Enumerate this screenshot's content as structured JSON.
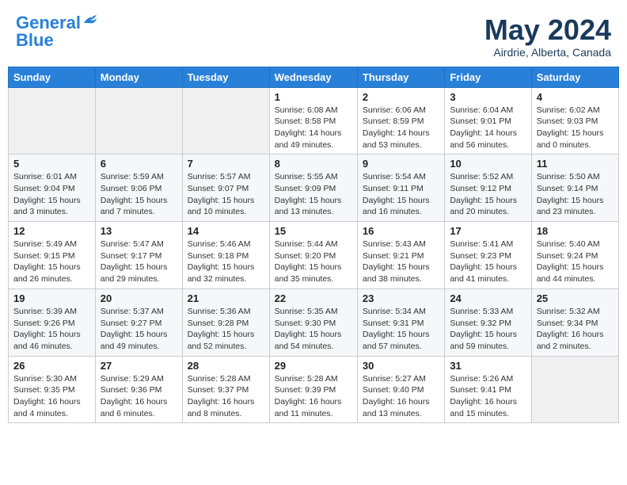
{
  "header": {
    "logo_line1": "General",
    "logo_line2": "Blue",
    "month_year": "May 2024",
    "location": "Airdrie, Alberta, Canada"
  },
  "weekdays": [
    "Sunday",
    "Monday",
    "Tuesday",
    "Wednesday",
    "Thursday",
    "Friday",
    "Saturday"
  ],
  "weeks": [
    [
      {
        "day": "",
        "info": ""
      },
      {
        "day": "",
        "info": ""
      },
      {
        "day": "",
        "info": ""
      },
      {
        "day": "1",
        "info": "Sunrise: 6:08 AM\nSunset: 8:58 PM\nDaylight: 14 hours\nand 49 minutes."
      },
      {
        "day": "2",
        "info": "Sunrise: 6:06 AM\nSunset: 8:59 PM\nDaylight: 14 hours\nand 53 minutes."
      },
      {
        "day": "3",
        "info": "Sunrise: 6:04 AM\nSunset: 9:01 PM\nDaylight: 14 hours\nand 56 minutes."
      },
      {
        "day": "4",
        "info": "Sunrise: 6:02 AM\nSunset: 9:03 PM\nDaylight: 15 hours\nand 0 minutes."
      }
    ],
    [
      {
        "day": "5",
        "info": "Sunrise: 6:01 AM\nSunset: 9:04 PM\nDaylight: 15 hours\nand 3 minutes."
      },
      {
        "day": "6",
        "info": "Sunrise: 5:59 AM\nSunset: 9:06 PM\nDaylight: 15 hours\nand 7 minutes."
      },
      {
        "day": "7",
        "info": "Sunrise: 5:57 AM\nSunset: 9:07 PM\nDaylight: 15 hours\nand 10 minutes."
      },
      {
        "day": "8",
        "info": "Sunrise: 5:55 AM\nSunset: 9:09 PM\nDaylight: 15 hours\nand 13 minutes."
      },
      {
        "day": "9",
        "info": "Sunrise: 5:54 AM\nSunset: 9:11 PM\nDaylight: 15 hours\nand 16 minutes."
      },
      {
        "day": "10",
        "info": "Sunrise: 5:52 AM\nSunset: 9:12 PM\nDaylight: 15 hours\nand 20 minutes."
      },
      {
        "day": "11",
        "info": "Sunrise: 5:50 AM\nSunset: 9:14 PM\nDaylight: 15 hours\nand 23 minutes."
      }
    ],
    [
      {
        "day": "12",
        "info": "Sunrise: 5:49 AM\nSunset: 9:15 PM\nDaylight: 15 hours\nand 26 minutes."
      },
      {
        "day": "13",
        "info": "Sunrise: 5:47 AM\nSunset: 9:17 PM\nDaylight: 15 hours\nand 29 minutes."
      },
      {
        "day": "14",
        "info": "Sunrise: 5:46 AM\nSunset: 9:18 PM\nDaylight: 15 hours\nand 32 minutes."
      },
      {
        "day": "15",
        "info": "Sunrise: 5:44 AM\nSunset: 9:20 PM\nDaylight: 15 hours\nand 35 minutes."
      },
      {
        "day": "16",
        "info": "Sunrise: 5:43 AM\nSunset: 9:21 PM\nDaylight: 15 hours\nand 38 minutes."
      },
      {
        "day": "17",
        "info": "Sunrise: 5:41 AM\nSunset: 9:23 PM\nDaylight: 15 hours\nand 41 minutes."
      },
      {
        "day": "18",
        "info": "Sunrise: 5:40 AM\nSunset: 9:24 PM\nDaylight: 15 hours\nand 44 minutes."
      }
    ],
    [
      {
        "day": "19",
        "info": "Sunrise: 5:39 AM\nSunset: 9:26 PM\nDaylight: 15 hours\nand 46 minutes."
      },
      {
        "day": "20",
        "info": "Sunrise: 5:37 AM\nSunset: 9:27 PM\nDaylight: 15 hours\nand 49 minutes."
      },
      {
        "day": "21",
        "info": "Sunrise: 5:36 AM\nSunset: 9:28 PM\nDaylight: 15 hours\nand 52 minutes."
      },
      {
        "day": "22",
        "info": "Sunrise: 5:35 AM\nSunset: 9:30 PM\nDaylight: 15 hours\nand 54 minutes."
      },
      {
        "day": "23",
        "info": "Sunrise: 5:34 AM\nSunset: 9:31 PM\nDaylight: 15 hours\nand 57 minutes."
      },
      {
        "day": "24",
        "info": "Sunrise: 5:33 AM\nSunset: 9:32 PM\nDaylight: 15 hours\nand 59 minutes."
      },
      {
        "day": "25",
        "info": "Sunrise: 5:32 AM\nSunset: 9:34 PM\nDaylight: 16 hours\nand 2 minutes."
      }
    ],
    [
      {
        "day": "26",
        "info": "Sunrise: 5:30 AM\nSunset: 9:35 PM\nDaylight: 16 hours\nand 4 minutes."
      },
      {
        "day": "27",
        "info": "Sunrise: 5:29 AM\nSunset: 9:36 PM\nDaylight: 16 hours\nand 6 minutes."
      },
      {
        "day": "28",
        "info": "Sunrise: 5:28 AM\nSunset: 9:37 PM\nDaylight: 16 hours\nand 8 minutes."
      },
      {
        "day": "29",
        "info": "Sunrise: 5:28 AM\nSunset: 9:39 PM\nDaylight: 16 hours\nand 11 minutes."
      },
      {
        "day": "30",
        "info": "Sunrise: 5:27 AM\nSunset: 9:40 PM\nDaylight: 16 hours\nand 13 minutes."
      },
      {
        "day": "31",
        "info": "Sunrise: 5:26 AM\nSunset: 9:41 PM\nDaylight: 16 hours\nand 15 minutes."
      },
      {
        "day": "",
        "info": ""
      }
    ]
  ]
}
